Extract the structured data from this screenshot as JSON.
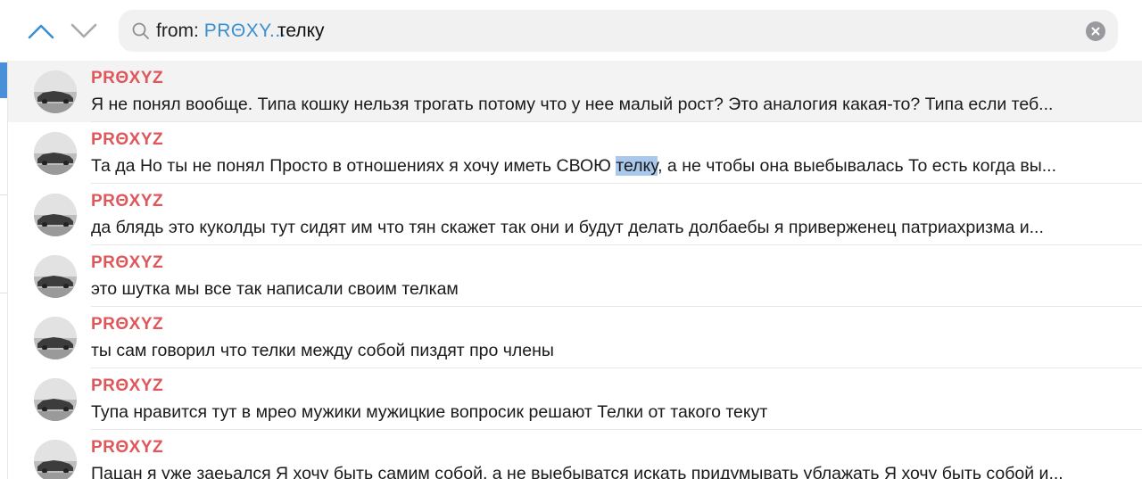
{
  "search": {
    "from_label": "from:",
    "from_value": "PRΘXY...",
    "query": "телку"
  },
  "icons": {
    "nav_up": "chevron-up-icon",
    "nav_down": "chevron-down-icon",
    "search": "search-icon",
    "clear": "clear-icon"
  },
  "colors": {
    "sender": "#e0575b",
    "accent": "#3a8fd0",
    "highlight": "#a9c8ec"
  },
  "results": [
    {
      "sender": "PRΘXYZ",
      "text_before": "Я не понял вообще. Типа кошку нельзя трогать потому что у нее малый рост? Это аналогия какая-то? Типа если теб...",
      "highlight": "",
      "text_after": ""
    },
    {
      "sender": "PRΘXYZ",
      "text_before": "Та да Но ты не понял Просто в отношениях я хочу иметь СВОЮ ",
      "highlight": "телку",
      "text_after": ", а не чтобы она выебывалась То есть когда вы..."
    },
    {
      "sender": "PRΘXYZ",
      "text_before": "да блядь это куколды тут сидят им что тян скажет так они и будут делать долбаебы я приверженец патриахризма и...",
      "highlight": "",
      "text_after": ""
    },
    {
      "sender": "PRΘXYZ",
      "text_before": "это шутка мы все так написали своим телкам",
      "highlight": "",
      "text_after": ""
    },
    {
      "sender": "PRΘXYZ",
      "text_before": "ты сам говорил что телки между собой пиздят про члены",
      "highlight": "",
      "text_after": ""
    },
    {
      "sender": "PRΘXYZ",
      "text_before": "Тупа нравится тут в мрео мужики мужицкие вопросик решают Телки от такого текут",
      "highlight": "",
      "text_after": ""
    },
    {
      "sender": "PRΘXYZ",
      "text_before": "Пацан я уже заеьался Я хочу быть самим собой, а не выебыватся искать придумывать ублажать Я хочу быть собой и...",
      "highlight": "",
      "text_after": ""
    }
  ]
}
